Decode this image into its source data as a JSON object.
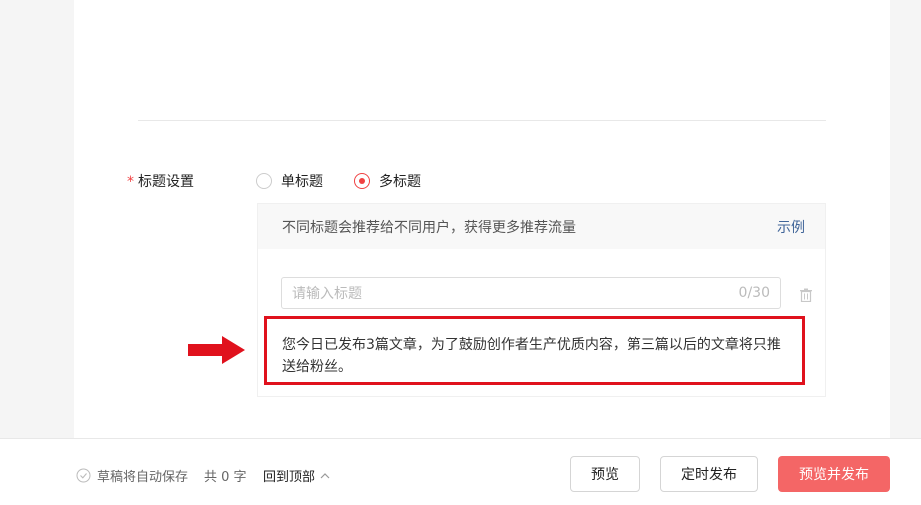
{
  "title_setting": {
    "required_mark": "*",
    "label": "标题设置",
    "options": [
      {
        "label": "单标题",
        "checked": false
      },
      {
        "label": "多标题",
        "checked": true
      }
    ]
  },
  "panel": {
    "hint": "不同标题会推荐给不同用户，获得更多推荐流量",
    "example_link": "示例",
    "input_placeholder": "请输入标题",
    "counter": "0/30",
    "warning": "您今日已发布3篇文章，为了鼓励创作者生产优质内容，第三篇以后的文章将只推送给粉丝。"
  },
  "footer": {
    "autosave": "草稿将自动保存",
    "word_count": "共 0 字",
    "back_to_top": "回到顶部",
    "preview": "预览",
    "schedule": "定时发布",
    "preview_publish": "预览并发布"
  },
  "colors": {
    "accent": "#f04142",
    "primary_button": "#f46666",
    "link": "#406599",
    "annotation": "#e0111d"
  }
}
